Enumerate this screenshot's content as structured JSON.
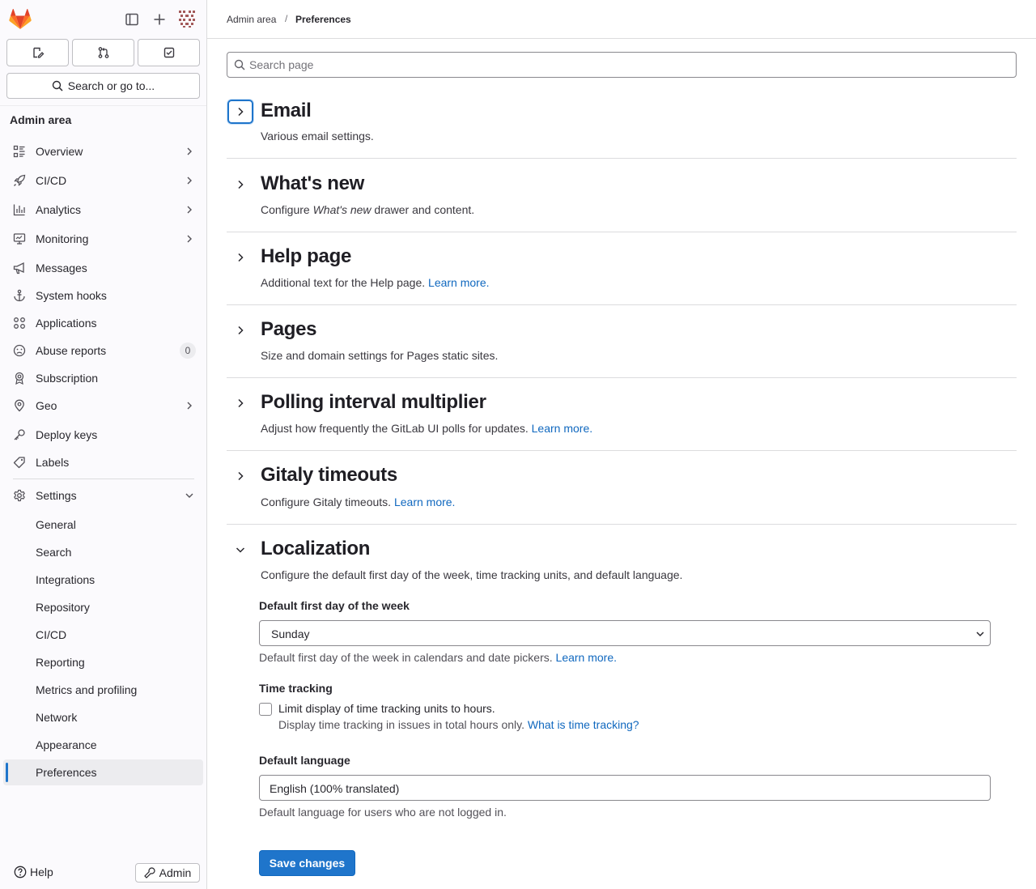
{
  "sidebar": {
    "search_label": "Search or go to...",
    "section_title": "Admin area",
    "items": [
      {
        "label": "Overview",
        "icon": "overview-icon",
        "chevron": true
      },
      {
        "label": "CI/CD",
        "icon": "rocket-icon",
        "chevron": true
      },
      {
        "label": "Analytics",
        "icon": "chart-icon",
        "chevron": true
      },
      {
        "label": "Monitoring",
        "icon": "monitor-icon",
        "chevron": true
      },
      {
        "label": "Messages",
        "icon": "megaphone-icon",
        "chevron": false
      },
      {
        "label": "System hooks",
        "icon": "anchor-icon",
        "chevron": false
      },
      {
        "label": "Applications",
        "icon": "applications-icon",
        "chevron": false
      },
      {
        "label": "Abuse reports",
        "icon": "abuse-icon",
        "badge": "0"
      },
      {
        "label": "Subscription",
        "icon": "license-icon",
        "chevron": false
      },
      {
        "label": "Geo",
        "icon": "location-icon",
        "chevron": true
      },
      {
        "label": "Deploy keys",
        "icon": "key-icon",
        "chevron": false
      },
      {
        "label": "Labels",
        "icon": "label-icon",
        "chevron": false
      }
    ],
    "settings": {
      "label": "Settings",
      "icon": "gear-icon",
      "children": [
        "General",
        "Search",
        "Integrations",
        "Repository",
        "CI/CD",
        "Reporting",
        "Metrics and profiling",
        "Network",
        "Appearance",
        "Preferences"
      ],
      "active": "Preferences"
    },
    "help_label": "Help",
    "admin_label": "Admin"
  },
  "breadcrumb": {
    "parent": "Admin area",
    "separator": "/",
    "current": "Preferences"
  },
  "search": {
    "placeholder": "Search page"
  },
  "sections": [
    {
      "title": "Email",
      "description": "Various email settings.",
      "expanded": false
    },
    {
      "title": "What's new",
      "desc_before": "Configure ",
      "desc_em": "What's new",
      "desc_after": " drawer and content.",
      "expanded": false
    },
    {
      "title": "Help page",
      "description": "Additional text for the Help page.",
      "link": "Learn more.",
      "expanded": false
    },
    {
      "title": "Pages",
      "description": "Size and domain settings for Pages static sites.",
      "expanded": false
    },
    {
      "title": "Polling interval multiplier",
      "description": "Adjust how frequently the GitLab UI polls for updates.",
      "link": "Learn more.",
      "expanded": false
    },
    {
      "title": "Gitaly timeouts",
      "description": "Configure Gitaly timeouts.",
      "link": "Learn more.",
      "expanded": false
    },
    {
      "title": "Localization",
      "description": "Configure the default first day of the week, time tracking units, and default language.",
      "expanded": true
    }
  ],
  "localization": {
    "first_day_label": "Default first day of the week",
    "first_day_value": "Sunday",
    "first_day_help": "Default first day of the week in calendars and date pickers.",
    "first_day_link": "Learn more.",
    "time_tracking_label": "Time tracking",
    "time_tracking_checkbox": "Limit display of time tracking units to hours.",
    "time_tracking_help": "Display time tracking in issues in total hours only.",
    "time_tracking_link": "What is time tracking?",
    "language_label": "Default language",
    "language_value": "English (100% translated)",
    "language_help": "Default language for users who are not logged in.",
    "save_label": "Save changes"
  },
  "colors": {
    "accent": "#1f75cb",
    "link": "#1068bf",
    "logo_orange": "#e24329"
  }
}
